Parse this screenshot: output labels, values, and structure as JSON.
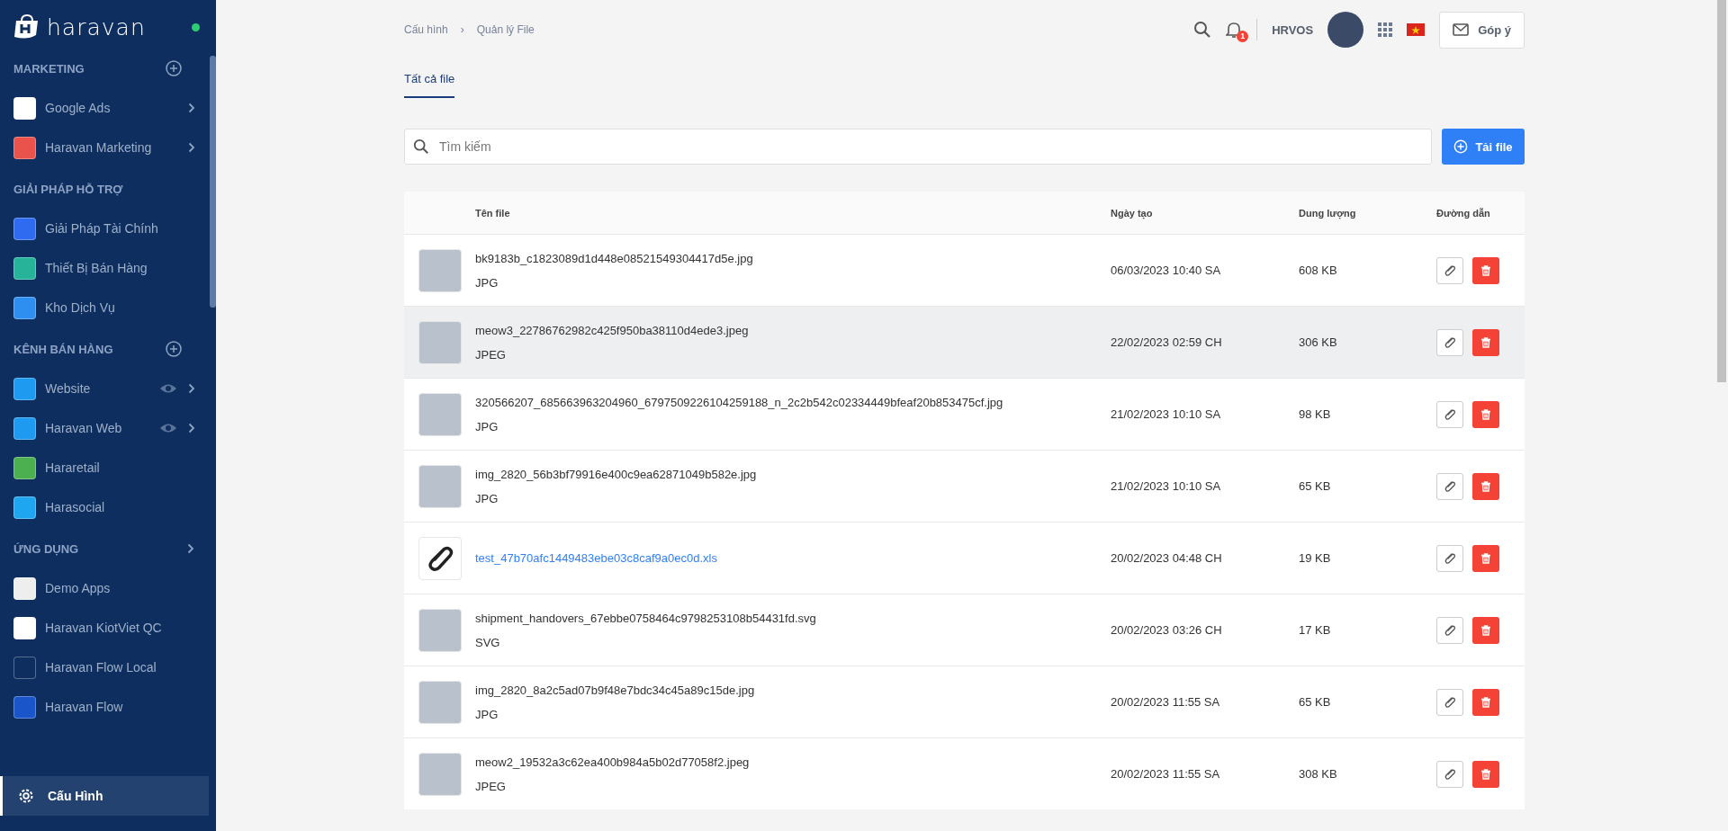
{
  "sidebar": {
    "logo": "haravan",
    "online": true,
    "sections": [
      {
        "title": "MARKETING",
        "kind": "add",
        "items": [
          {
            "label": "Google Ads",
            "color": "#ffffff",
            "chevron": true,
            "eye": false,
            "selected": false
          },
          {
            "label": "Haravan Marketing",
            "color": "#e9534b",
            "chevron": true,
            "eye": false,
            "selected": false
          }
        ]
      },
      {
        "title": "GIẢI PHÁP HỖ TRỢ",
        "kind": "plain",
        "items": [
          {
            "label": "Giải Pháp Tài Chính",
            "color": "#2f6bf0",
            "chevron": false,
            "eye": false,
            "selected": false
          },
          {
            "label": "Thiết Bị Bán Hàng",
            "color": "#26b39a",
            "chevron": false,
            "eye": false,
            "selected": false
          },
          {
            "label": "Kho Dịch Vụ",
            "color": "#2f8ff0",
            "chevron": false,
            "eye": false,
            "selected": false
          }
        ]
      },
      {
        "title": "KÊNH BÁN HÀNG",
        "kind": "add",
        "items": [
          {
            "label": "Website",
            "color": "#1e9bf0",
            "chevron": true,
            "eye": true,
            "selected": false
          },
          {
            "label": "Haravan Web",
            "color": "#1e9bf0",
            "chevron": true,
            "eye": true,
            "selected": false
          },
          {
            "label": "Hararetail",
            "color": "#4caf50",
            "chevron": false,
            "eye": false,
            "selected": false
          },
          {
            "label": "Harasocial",
            "color": "#1ea7f0",
            "chevron": false,
            "eye": false,
            "selected": false
          }
        ]
      },
      {
        "title": "ỨNG DỤNG",
        "kind": "expand",
        "items": [
          {
            "label": "Demo Apps",
            "color": "#eeeeee",
            "chevron": false,
            "eye": false,
            "selected": false
          },
          {
            "label": "Haravan KiotViet QC",
            "color": "#ffffff",
            "chevron": false,
            "eye": false,
            "selected": false
          },
          {
            "label": "Haravan Flow Local",
            "color": "#0d2e5f",
            "chevron": false,
            "eye": false,
            "selected": false
          },
          {
            "label": "Haravan Flow",
            "color": "#1a56c9",
            "chevron": false,
            "eye": false,
            "selected": false
          }
        ]
      }
    ],
    "settings": {
      "label": "Cấu Hình",
      "selected": true
    }
  },
  "header": {
    "breadcrumb": [
      "Cấu hình",
      "Quản lý File"
    ],
    "separator": "›",
    "notification_count": "1",
    "account": "HRVOS",
    "feedback": "Góp ý"
  },
  "tabs": [
    {
      "label": "Tất cả file",
      "selected": true
    }
  ],
  "search": {
    "placeholder": "Tìm kiếm"
  },
  "upload_button": "Tải file",
  "table": {
    "columns": [
      "Tên file",
      "Ngày tạo",
      "Dung lượng",
      "Đường dẫn"
    ],
    "rows": [
      {
        "kind": "image",
        "name": "bk9183b_c1823089d1d448e08521549304417d5e.jpg",
        "type": "JPG",
        "date": "06/03/2023 10:40 SA",
        "size": "608 KB",
        "highlighted": false
      },
      {
        "kind": "image",
        "name": "meow3_22786762982c425f950ba38110d4ede3.jpeg",
        "type": "JPEG",
        "date": "22/02/2023 02:59 CH",
        "size": "306 KB",
        "highlighted": true
      },
      {
        "kind": "image",
        "name": "320566207_685663963204960_6797509226104259188_n_2c2b542c02334449bfeaf20b853475cf.jpg",
        "type": "JPG",
        "date": "21/02/2023 10:10 SA",
        "size": "98 KB",
        "highlighted": false
      },
      {
        "kind": "image",
        "name": "img_2820_56b3bf79916e400c9ea62871049b582e.jpg",
        "type": "JPG",
        "date": "21/02/2023 10:10 SA",
        "size": "65 KB",
        "highlighted": false
      },
      {
        "kind": "link",
        "name": "test_47b70afc1449483ebe03c8caf9a0ec0d.xls",
        "date": "20/02/2023 04:48 CH",
        "size": "19 KB",
        "highlighted": false
      },
      {
        "kind": "image",
        "name": "shipment_handovers_67ebbe0758464c9798253108b54431fd.svg",
        "type": "SVG",
        "date": "20/02/2023 03:26 CH",
        "size": "17 KB",
        "highlighted": false
      },
      {
        "kind": "image",
        "name": "img_2820_8a2c5ad07b9f48e7bdc34c45a89c15de.jpg",
        "type": "JPG",
        "date": "20/02/2023 11:55 SA",
        "size": "65 KB",
        "highlighted": false
      },
      {
        "kind": "image",
        "name": "meow2_19532a3c62ea400b984a5b02d77058f2.jpeg",
        "type": "JPEG",
        "date": "20/02/2023 11:55 SA",
        "size": "308 KB",
        "highlighted": false
      }
    ]
  }
}
